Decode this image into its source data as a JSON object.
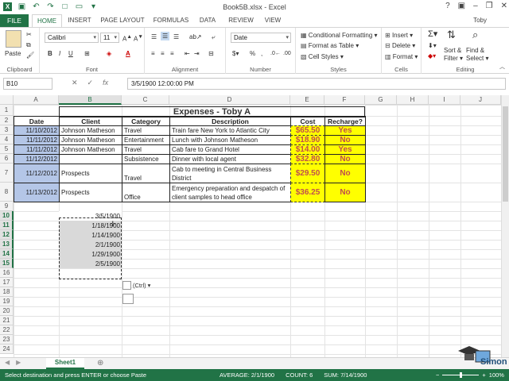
{
  "window": {
    "title": "Book5B.xlsx - Excel",
    "user": "Toby"
  },
  "ribbon_tabs": [
    "FILE",
    "HOME",
    "INSERT",
    "PAGE LAYOUT",
    "FORMULAS",
    "DATA",
    "REVIEW",
    "VIEW"
  ],
  "ribbon": {
    "clipboard": {
      "paste": "Paste",
      "label": "Clipboard"
    },
    "font": {
      "name": "Calibri",
      "size": "11",
      "label": "Font"
    },
    "alignment": {
      "label": "Alignment"
    },
    "number": {
      "format": "Date",
      "label": "Number"
    },
    "styles": {
      "conditional": "Conditional Formatting",
      "format_table": "Format as Table",
      "cell_styles": "Cell Styles",
      "label": "Styles"
    },
    "cells": {
      "insert": "Insert",
      "delete": "Delete",
      "format": "Format",
      "label": "Cells"
    },
    "editing": {
      "sort": "Sort &",
      "filter": "Filter",
      "find": "Find &",
      "select": "Select",
      "label": "Editing"
    }
  },
  "formula_bar": {
    "name_box": "B10",
    "fx": "fx",
    "content": "3/5/1900  12:00:00 PM"
  },
  "columns": [
    "A",
    "B",
    "C",
    "D",
    "E",
    "F",
    "G",
    "H",
    "I",
    "J"
  ],
  "rows": [
    "1",
    "2",
    "3",
    "4",
    "5",
    "6",
    "7",
    "8",
    "9",
    "10",
    "11",
    "12",
    "13",
    "14",
    "15",
    "16",
    "17",
    "18",
    "19",
    "20",
    "21",
    "22",
    "23",
    "24"
  ],
  "table": {
    "title": "Expenses - Toby A",
    "headers": [
      "Date",
      "Client",
      "Category",
      "Description",
      "Cost",
      "Recharge?"
    ],
    "rows": [
      [
        "11/10/2012",
        "Johnson Matheson",
        "Travel",
        "Train fare New York to Atlantic City",
        "$65.50",
        "Yes"
      ],
      [
        "11/11/2012",
        "Johnson Matheson",
        "Entertainment",
        "Lunch with Johnson Matheson",
        "$18.90",
        "No"
      ],
      [
        "11/11/2012",
        "Johnson Matheson",
        "Travel",
        "Cab fare to Grand Hotel",
        "$14.00",
        "Yes"
      ],
      [
        "11/12/2012",
        "",
        "Subsistence",
        "Dinner with local agent",
        "$32.80",
        "No"
      ],
      [
        "11/12/2012",
        "Prospects",
        "Travel",
        "Cab to meeting in Central Business District",
        "$29.50",
        "No"
      ],
      [
        "11/13/2012",
        "Prospects",
        "Office",
        "Emergency preparation and despatch of client samples to head office",
        "$36.25",
        "No"
      ]
    ]
  },
  "pasted_values": [
    "3/5/1900",
    "1/18/1900",
    "1/14/1900",
    "2/1/1900",
    "1/29/1900",
    "2/5/1900"
  ],
  "paste_options": "(Ctrl)",
  "sheet_tab": "Sheet1",
  "status": {
    "message": "Select destination and press ENTER or choose Paste",
    "average": "AVERAGE: 2/1/1900",
    "count": "COUNT: 6",
    "sum": "SUM: 7/14/1900",
    "zoom": "100%"
  },
  "watermark": "Simon",
  "colors": {
    "excel_green": "#217346",
    "date_fill": "#b4c6e7",
    "cost_fill": "#ffff00",
    "cost_text": "#c0504d"
  }
}
